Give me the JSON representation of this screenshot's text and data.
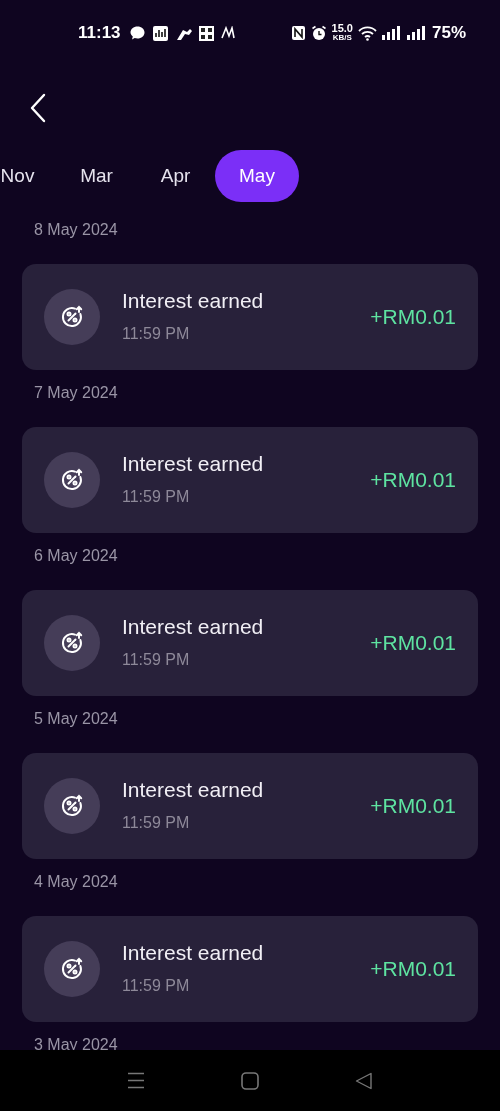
{
  "status_bar": {
    "time": "11:13",
    "speed_value": "15.0",
    "speed_unit": "KB/S",
    "battery": "75%"
  },
  "tabs": [
    {
      "label": "Nov",
      "selected": false
    },
    {
      "label": "Mar",
      "selected": false
    },
    {
      "label": "Apr",
      "selected": false
    },
    {
      "label": "May",
      "selected": true
    }
  ],
  "groups": [
    {
      "date": "8 May 2024",
      "transactions": [
        {
          "title": "Interest earned",
          "time": "11:59 PM",
          "amount": "+RM0.01"
        }
      ]
    },
    {
      "date": "7 May 2024",
      "transactions": [
        {
          "title": "Interest earned",
          "time": "11:59 PM",
          "amount": "+RM0.01"
        }
      ]
    },
    {
      "date": "6 May 2024",
      "transactions": [
        {
          "title": "Interest earned",
          "time": "11:59 PM",
          "amount": "+RM0.01"
        }
      ]
    },
    {
      "date": "5 May 2024",
      "transactions": [
        {
          "title": "Interest earned",
          "time": "11:59 PM",
          "amount": "+RM0.01"
        }
      ]
    },
    {
      "date": "4 May 2024",
      "transactions": [
        {
          "title": "Interest earned",
          "time": "11:59 PM",
          "amount": "+RM0.01"
        }
      ]
    },
    {
      "date": "3 May 2024"
    }
  ]
}
